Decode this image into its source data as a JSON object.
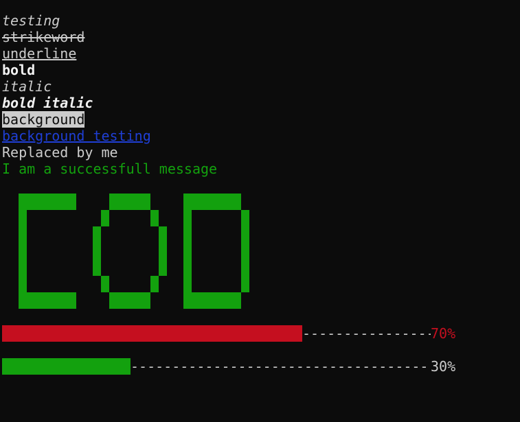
{
  "lines": {
    "italic_testing": "testing",
    "strikethrough": "strikeword",
    "underline": "underline",
    "bold": "bold",
    "italic": "italic",
    "bold_italic": "bold italic",
    "background": "background",
    "background_link": "background testing",
    "replaced": "Replaced by me",
    "success": "I am a successfull message"
  },
  "banner": {
    "text": "COD",
    "color": "#13a10e"
  },
  "progress_bars": [
    {
      "label": "70%",
      "progress": 0.7,
      "fill_color": "#c50f1f",
      "label_color": "#c50f1f"
    },
    {
      "label": "30%",
      "progress": 0.3,
      "fill_color": "#13a10e",
      "label_color": "#cccccc"
    }
  ],
  "colors": {
    "background": "#0c0c0c",
    "text": "#cccccc",
    "link_blue": "#1f3fd6",
    "success_green": "#13a10e",
    "error_red": "#c50f1f"
  }
}
